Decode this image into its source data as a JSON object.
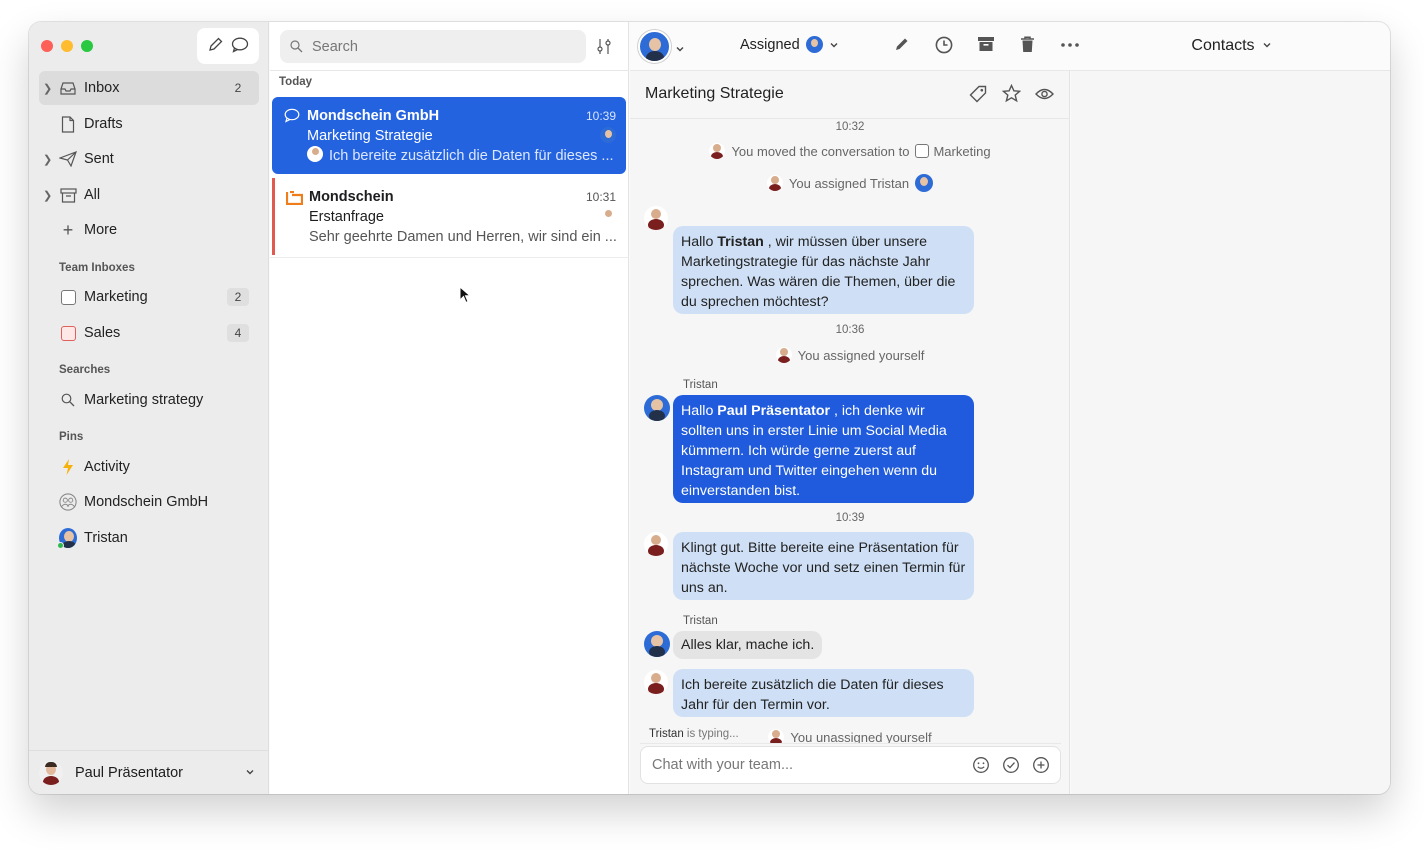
{
  "sidebar": {
    "items": [
      {
        "label": "Inbox",
        "count": "2"
      },
      {
        "label": "Drafts"
      },
      {
        "label": "Sent"
      },
      {
        "label": "All"
      },
      {
        "label": "More"
      }
    ],
    "team_inboxes_heading": "Team Inboxes",
    "team_inboxes": [
      {
        "label": "Marketing",
        "count": "2"
      },
      {
        "label": "Sales",
        "count": "4"
      }
    ],
    "searches_heading": "Searches",
    "searches": [
      {
        "label": "Marketing strategy"
      }
    ],
    "pins_heading": "Pins",
    "pins": [
      {
        "label": "Activity"
      },
      {
        "label": "Mondschein GmbH"
      },
      {
        "label": "Tristan"
      }
    ],
    "user_name": "Paul Präsentator"
  },
  "list": {
    "search_placeholder": "Search",
    "section": "Today",
    "conversations": [
      {
        "from": "Mondschein GmbH",
        "time": "10:39",
        "subject": "Marketing Strategie",
        "preview": "Ich bereite zusätzlich die Daten für dieses ..."
      },
      {
        "from": "Mondschein",
        "time": "10:31",
        "subject": "Erstanfrage",
        "preview": "Sehr geehrte Damen und Herren, wir sind ein ..."
      }
    ]
  },
  "toolbar": {
    "assigned_label": "Assigned",
    "contacts_label": "Contacts"
  },
  "conversation": {
    "title": "Marketing Strategie",
    "events": {
      "ts1": "10:32",
      "moved": "You moved the conversation to",
      "moved_target": "Marketing",
      "assigned_tristan": "You assigned Tristan",
      "ts2": "10:36",
      "assigned_self": "You assigned yourself",
      "ts3": "10:39",
      "unassigned_self": "You unassigned yourself"
    },
    "messages": {
      "m1_pre": "Hallo ",
      "m1_name": "Tristan",
      "m1_post": " , wir müssen über unsere Marketingstrategie für das nächste Jahr sprechen. Was wären die Themen, über die du sprechen möchtest?",
      "m2_sender": "Tristan",
      "m2_pre": "Hallo ",
      "m2_name": "Paul Präsentator",
      "m2_post": " , ich denke wir sollten uns in erster Linie um Social Media kümmern. Ich würde gerne zuerst auf Instagram und Twitter eingehen wenn du einverstanden bist.",
      "m3": "Klingt gut. Bitte bereite eine Präsentation für nächste Woche vor und setz einen Termin für uns an.",
      "m4_sender": "Tristan",
      "m4": "Alles klar, mache ich.",
      "m5": "Ich bereite zusätzlich die Daten für dieses Jahr für den Termin vor."
    },
    "typing_name": "Tristan",
    "typing_text": " is typing...",
    "composer_placeholder": "Chat with your team..."
  },
  "colors": {
    "accent": "#2463e0",
    "bubble_teammate": "#cfe0f6",
    "bubble_self": "#1f5bdc"
  }
}
